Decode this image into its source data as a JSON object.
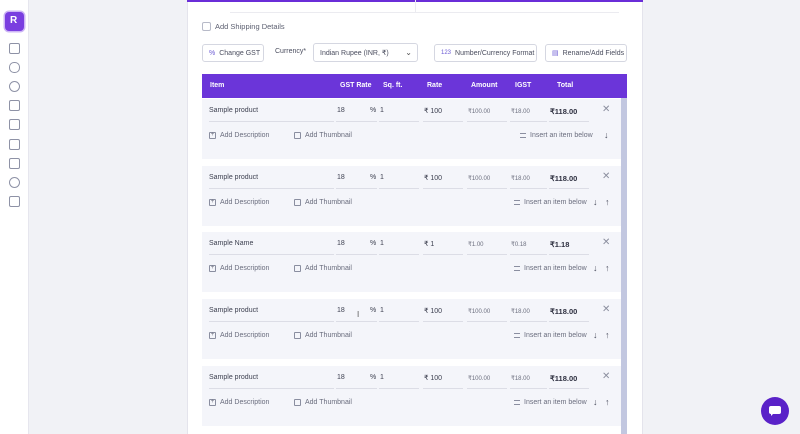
{
  "app": {
    "logo_letter": "R"
  },
  "sidebar": {
    "icons": [
      "list-icon",
      "cloud-icon",
      "user-icon",
      "box-icon",
      "document-icon",
      "file-icon",
      "bank-icon",
      "gear-icon",
      "receipt-icon"
    ]
  },
  "form": {
    "shipping_label": "Add Shipping Details",
    "change_gst_label": "Change GST",
    "currency_label": "Currency*",
    "currency_value": "Indian Rupee (INR, ₹)",
    "number_format_label": "Number/Currency Format",
    "number_format_icon_text": "123",
    "rename_label": "Rename/Add Fields"
  },
  "table": {
    "headers": {
      "item": "Item",
      "gst": "GST Rate",
      "sqft": "Sq. ft.",
      "rate": "Rate",
      "amount": "Amount",
      "igst": "IGST",
      "total": "Total"
    },
    "rows": [
      {
        "name": "Sample product",
        "gst": "18",
        "pct": "%",
        "qty": "1",
        "rate": "₹ 100",
        "amount": "₹100.00",
        "igst": "₹18.00",
        "total": "₹118.00",
        "desc": "Add Description",
        "thumb": "Add Thumbnail",
        "insert": "Insert an item below",
        "down": "↓",
        "up": ""
      },
      {
        "name": "Sample product",
        "gst": "18",
        "pct": "%",
        "qty": "1",
        "rate": "₹ 100",
        "amount": "₹100.00",
        "igst": "₹18.00",
        "total": "₹118.00",
        "desc": "Add Description",
        "thumb": "Add Thumbnail",
        "insert": "Insert an item below",
        "down": "↓",
        "up": "↑"
      },
      {
        "name": "Sample Name",
        "gst": "18",
        "pct": "%",
        "qty": "1",
        "rate": "₹ 1",
        "amount": "₹1.00",
        "igst": "₹0.18",
        "total": "₹1.18",
        "desc": "Add Description",
        "thumb": "Add Thumbnail",
        "insert": "Insert an item below",
        "down": "↓",
        "up": "↑"
      },
      {
        "name": "Sample product",
        "gst": "18",
        "pct": "%",
        "qty": "1",
        "rate": "₹ 100",
        "amount": "₹100.00",
        "igst": "₹18.00",
        "total": "₹118.00",
        "desc": "Add Description",
        "thumb": "Add Thumbnail",
        "insert": "Insert an item below",
        "down": "↓",
        "up": "↑"
      },
      {
        "name": "Sample product",
        "gst": "18",
        "pct": "%",
        "qty": "1",
        "rate": "₹ 100",
        "amount": "₹100.00",
        "igst": "₹18.00",
        "total": "₹118.00",
        "desc": "Add Description",
        "thumb": "Add Thumbnail",
        "insert": "Insert an item below",
        "down": "↓",
        "up": "↑"
      }
    ]
  },
  "colors": {
    "accent": "#6b35d9",
    "chat": "#5a22c8",
    "row_bg": "#f4f5fa"
  }
}
